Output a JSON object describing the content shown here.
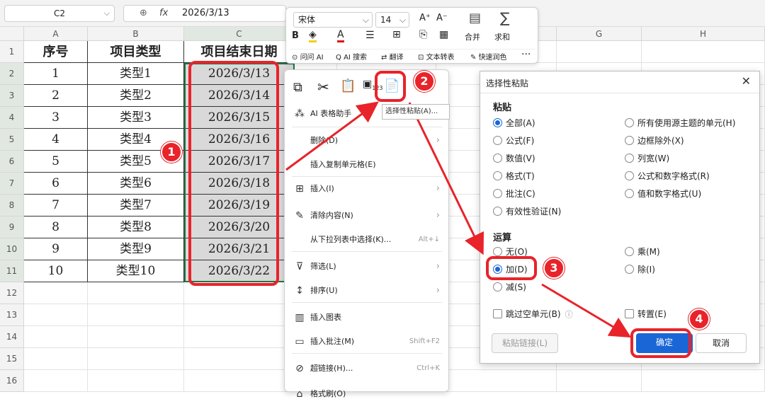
{
  "formula_bar": {
    "cell_ref": "C2",
    "fx_label": "fx",
    "formula": "2026/3/13"
  },
  "columns": [
    "A",
    "B",
    "C",
    "D",
    "E",
    "F",
    "G",
    "H"
  ],
  "rows": [
    "1",
    "2",
    "3",
    "4",
    "5",
    "6",
    "7",
    "8",
    "9",
    "10",
    "11",
    "12",
    "13",
    "14",
    "15",
    "16"
  ],
  "table": {
    "headers": [
      "序号",
      "项目类型",
      "项目结束日期"
    ],
    "rows": [
      [
        "1",
        "类型1",
        "2026/3/13"
      ],
      [
        "2",
        "类型2",
        "2026/3/14"
      ],
      [
        "3",
        "类型3",
        "2026/3/15"
      ],
      [
        "4",
        "类型4",
        "2026/3/16"
      ],
      [
        "5",
        "类型5",
        "2026/3/17"
      ],
      [
        "6",
        "类型6",
        "2026/3/18"
      ],
      [
        "7",
        "类型7",
        "2026/3/19"
      ],
      [
        "8",
        "类型8",
        "2026/3/20"
      ],
      [
        "9",
        "类型9",
        "2026/3/21"
      ],
      [
        "10",
        "类型10",
        "2026/3/22"
      ]
    ]
  },
  "format_toolbar": {
    "font": "宋体",
    "size": "14",
    "merge": "合并",
    "sum": "求和",
    "ai_ask": "问问 AI",
    "ai_search": "AI 搜索",
    "translate": "翻译",
    "text_to_table": "文本转表",
    "quick_color": "快速润色"
  },
  "context_menu": {
    "tooltip": "选择性粘贴(A)...",
    "ai_table": "AI 表格助手",
    "items": [
      {
        "label": "删除(D)",
        "shortcut": ""
      },
      {
        "label": "插入复制单元格(E)",
        "shortcut": ""
      },
      {
        "label": "插入(I)",
        "shortcut": ""
      },
      {
        "label": "清除内容(N)",
        "shortcut": ""
      },
      {
        "label": "从下拉列表中选择(K)...",
        "shortcut": "Alt+↓"
      },
      {
        "label": "筛选(L)",
        "shortcut": ""
      },
      {
        "label": "排序(U)",
        "shortcut": ""
      },
      {
        "label": "插入图表",
        "shortcut": ""
      },
      {
        "label": "插入批注(M)",
        "shortcut": "Shift+F2"
      },
      {
        "label": "超链接(H)...",
        "shortcut": "Ctrl+K"
      },
      {
        "label": "格式刷(O)",
        "shortcut": ""
      }
    ]
  },
  "dialog": {
    "title": "选择性粘贴",
    "paste_section": "粘贴",
    "paste_left": [
      "全部(A)",
      "公式(F)",
      "数值(V)",
      "格式(T)",
      "批注(C)",
      "有效性验证(N)"
    ],
    "paste_right": [
      "所有使用源主题的单元(H)",
      "边框除外(X)",
      "列宽(W)",
      "公式和数字格式(R)",
      "值和数字格式(U)"
    ],
    "operation_section": "运算",
    "op_left": [
      "无(O)",
      "加(D)",
      "减(S)"
    ],
    "op_right": [
      "乘(M)",
      "除(I)"
    ],
    "skip_blanks": "跳过空单元(B)",
    "transpose": "转置(E)",
    "paste_link": "粘贴链接(L)",
    "ok": "确定",
    "cancel": "取消"
  },
  "badges": [
    "1",
    "2",
    "3",
    "4"
  ],
  "colors": {
    "accent": "#e8232a",
    "primary": "#1a66d6",
    "selection": "#217346"
  }
}
